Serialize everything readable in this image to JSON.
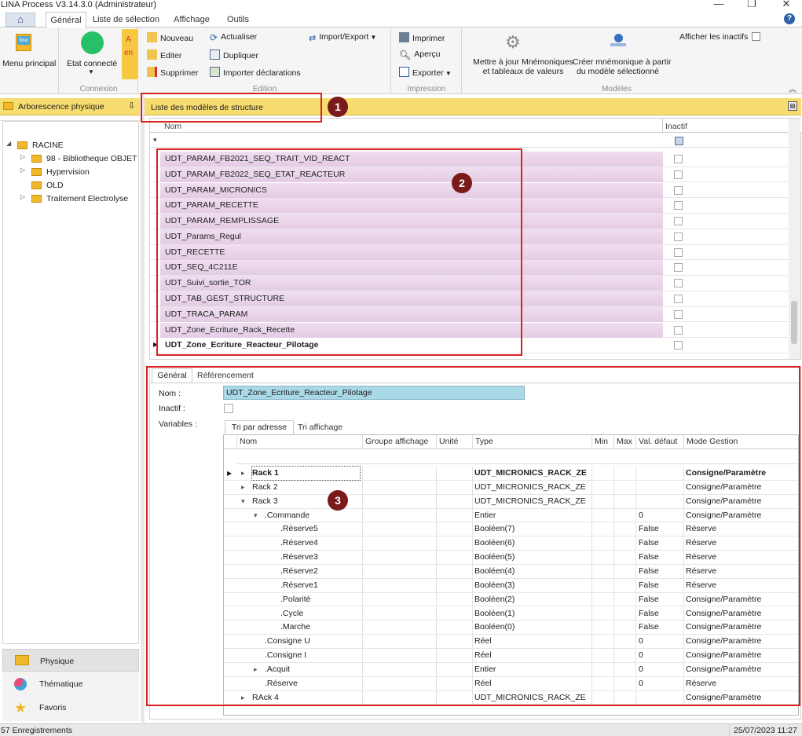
{
  "window": {
    "title": "LINA Process  V3.14.3.0  (Administrateur)"
  },
  "tabs": [
    "Général",
    "Liste de sélection",
    "Affichage",
    "Outils"
  ],
  "ribbon": {
    "menu_principal": "Menu principal",
    "etat_connecte": "Etat connecté",
    "connexion_group": "Connexion",
    "nouveau": "Nouveau",
    "editer": "Editer",
    "supprimer": "Supprimer",
    "actualiser": "Actualiser",
    "dupliquer": "Dupliquer",
    "importer": "Importer déclarations",
    "import_export": "Import/Export",
    "edition_group": "Edition",
    "imprimer": "Imprimer",
    "apercu": "Aperçu",
    "exporter": "Exporter",
    "impression_group": "Impression",
    "maj_line1": "Mettre à jour Mnémoniques",
    "maj_line2": "et tableaux de valeurs",
    "creer_line1": "Créer mnémonique à partir",
    "creer_line2": "du modèle sélectionné",
    "modeles_group": "Modèles",
    "afficher_inactifs": "Afficher les inactifs",
    "cut_a": "A",
    "cut_en": "en"
  },
  "left_panel": {
    "title": "Arborescence physique",
    "tree": [
      {
        "label": "RACINE",
        "level": 0,
        "expander": "◢"
      },
      {
        "label": "98 - Bibliotheque OBJET",
        "level": 1,
        "expander": "▷"
      },
      {
        "label": "Hypervision",
        "level": 1,
        "expander": "▷"
      },
      {
        "label": "OLD",
        "level": 1,
        "expander": ""
      },
      {
        "label": "Traitement Electrolyse",
        "level": 1,
        "expander": "▷"
      }
    ],
    "nav": [
      {
        "label": "Physique",
        "icon": "folder-icon"
      },
      {
        "label": "Thématique",
        "icon": "thematic-icon"
      },
      {
        "label": "Favoris",
        "icon": "star-icon"
      }
    ]
  },
  "list": {
    "title": "Liste des modèles de structure",
    "col_nom": "Nom",
    "col_inactif": "Inactif",
    "rows": [
      "UDT_PARAM_FB2021_SEQ_TRAIT_VID_REACT",
      "UDT_PARAM_FB2022_SEQ_ETAT_REACTEUR",
      "UDT_PARAM_MICRONICS",
      "UDT_PARAM_RECETTE",
      "UDT_PARAM_REMPLISSAGE",
      "UDT_Params_Regul",
      "UDT_RECETTE",
      "UDT_SEQ_4C211E",
      "UDT_Suivi_sortie_TOR",
      "UDT_TAB_GEST_STRUCTURE",
      "UDT_TRACA_PARAM",
      "UDT_Zone_Ecriture_Rack_Recette",
      "UDT_Zone_Ecriture_Reacteur_Pilotage"
    ]
  },
  "detail": {
    "tabs": [
      "Général",
      "Référencement"
    ],
    "nom_label": "Nom :",
    "nom_value": "UDT_Zone_Ecriture_Reacteur_Pilotage",
    "inactif_label": "Inactif :",
    "variables_label": "Variables :",
    "subtabs": [
      "Tri par adresse",
      "Tri affichage"
    ],
    "columns": [
      "Nom",
      "Groupe affichage",
      "Unité",
      "Type",
      "Min",
      "Max",
      "Val. défaut",
      "Mode Gestion"
    ],
    "rows": [
      {
        "nom": "Rack 1",
        "indent": 0,
        "exp": "▸",
        "type": "UDT_MICRONICS_RACK_ZE",
        "def": "",
        "mode": "Consigne/Paramètre",
        "bold": true
      },
      {
        "nom": "Rack 2",
        "indent": 0,
        "exp": "▸",
        "type": "UDT_MICRONICS_RACK_ZE",
        "def": "",
        "mode": "Consigne/Paramètre"
      },
      {
        "nom": "Rack 3",
        "indent": 0,
        "exp": "▾",
        "type": "UDT_MICRONICS_RACK_ZE",
        "def": "",
        "mode": "Consigne/Paramètre"
      },
      {
        "nom": ".Commande",
        "indent": 1,
        "exp": "▾",
        "type": "Entier",
        "def": "0",
        "mode": "Consigne/Paramètre"
      },
      {
        "nom": ".Réserve5",
        "indent": 2,
        "exp": "",
        "type": "Booléen(7)",
        "def": "False",
        "mode": "Réserve"
      },
      {
        "nom": ".Réserve4",
        "indent": 2,
        "exp": "",
        "type": "Booléen(6)",
        "def": "False",
        "mode": "Réserve"
      },
      {
        "nom": ".Réserve3",
        "indent": 2,
        "exp": "",
        "type": "Booléen(5)",
        "def": "False",
        "mode": "Réserve"
      },
      {
        "nom": ".Réserve2",
        "indent": 2,
        "exp": "",
        "type": "Booléen(4)",
        "def": "False",
        "mode": "Réserve"
      },
      {
        "nom": ".Réserve1",
        "indent": 2,
        "exp": "",
        "type": "Booléen(3)",
        "def": "False",
        "mode": "Réserve"
      },
      {
        "nom": ".Polarité",
        "indent": 2,
        "exp": "",
        "type": "Booléen(2)",
        "def": "False",
        "mode": "Consigne/Paramètre"
      },
      {
        "nom": ".Cycle",
        "indent": 2,
        "exp": "",
        "type": "Booléen(1)",
        "def": "False",
        "mode": "Consigne/Paramètre"
      },
      {
        "nom": ".Marche",
        "indent": 2,
        "exp": "",
        "type": "Booléen(0)",
        "def": "False",
        "mode": "Consigne/Paramètre"
      },
      {
        "nom": ".Consigne U",
        "indent": 1,
        "exp": "",
        "type": "Réel",
        "def": "0",
        "mode": "Consigne/Paramètre"
      },
      {
        "nom": ".Consigne I",
        "indent": 1,
        "exp": "",
        "type": "Réel",
        "def": "0",
        "mode": "Consigne/Paramètre"
      },
      {
        "nom": ".Acquit",
        "indent": 1,
        "exp": "▸",
        "type": "Entier",
        "def": "0",
        "mode": "Consigne/Paramètre"
      },
      {
        "nom": ".Réserve",
        "indent": 1,
        "exp": "",
        "type": "Réel",
        "def": "0",
        "mode": "Réserve"
      },
      {
        "nom": "RAck 4",
        "indent": 0,
        "exp": "▸",
        "type": "UDT_MICRONICS_RACK_ZE",
        "def": "",
        "mode": "Consigne/Paramètre"
      }
    ]
  },
  "status": {
    "left": "57 Enregistrements",
    "right": "25/07/2023 11:27"
  },
  "annotations": [
    "1",
    "2",
    "3"
  ],
  "colors": {
    "accent_yellow": "#f7dc6f",
    "row_pink": "#ead7ea",
    "highlight": "#d92121",
    "badge": "#7a1a1a",
    "name_field": "#a9d8e6"
  }
}
